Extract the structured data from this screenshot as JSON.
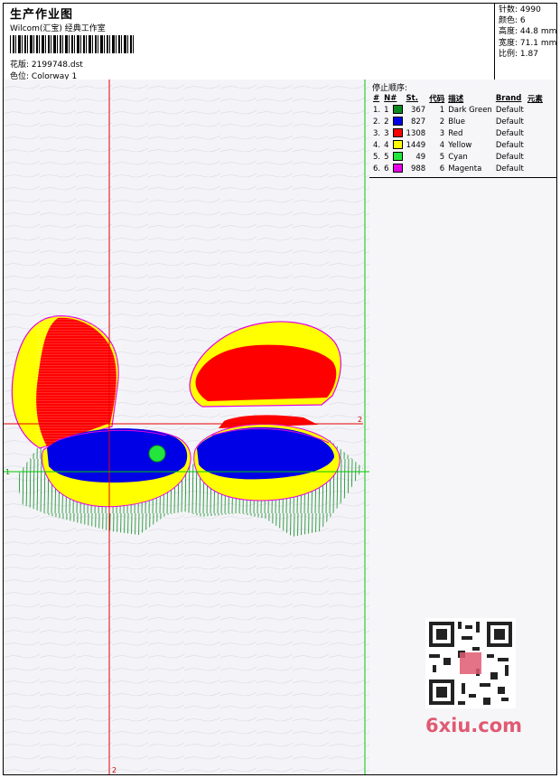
{
  "header": {
    "title": "生产作业图",
    "company": "Wilcom(汇宝) 经典工作室",
    "file_label": "花版:",
    "file_value": "2199748.dst",
    "colorway_label": "色位:",
    "colorway_value": "Colorway 1"
  },
  "stats": {
    "stitches_label": "针数:",
    "stitches": "4990",
    "colors_label": "颜色:",
    "colors": "6",
    "height_label": "高度:",
    "height": "44.8 mm",
    "width_label": "宽度:",
    "width": "71.1 mm",
    "scale_label": "比例:",
    "scale": "1.87"
  },
  "stop_sequence": {
    "title": "停止顺序:",
    "columns": [
      "#",
      "N#",
      "St.",
      "代码",
      "描述",
      "Brand",
      "元素"
    ],
    "rows": [
      {
        "idx": "1.",
        "n": "1",
        "color": "#0a8a1e",
        "st": "367",
        "code": "1",
        "desc": "Dark Green",
        "brand": "Default"
      },
      {
        "idx": "2.",
        "n": "2",
        "color": "#0000e6",
        "st": "827",
        "code": "2",
        "desc": "Blue",
        "brand": "Default"
      },
      {
        "idx": "3.",
        "n": "3",
        "color": "#ff0000",
        "st": "1308",
        "code": "3",
        "desc": "Red",
        "brand": "Default"
      },
      {
        "idx": "4.",
        "n": "4",
        "color": "#ffff00",
        "st": "1449",
        "code": "4",
        "desc": "Yellow",
        "brand": "Default"
      },
      {
        "idx": "5.",
        "n": "5",
        "color": "#22e63c",
        "st": "49",
        "code": "5",
        "desc": "Cyan",
        "brand": "Default"
      },
      {
        "idx": "6.",
        "n": "6",
        "color": "#e600e6",
        "st": "988",
        "code": "6",
        "desc": "Magenta",
        "brand": "Default"
      }
    ]
  },
  "guides": {
    "marker_1": "1",
    "marker_2": "2",
    "marker_2b": "2"
  },
  "watermark": {
    "text": "6xiu.com"
  },
  "colors": {
    "red_guide": "#e60000",
    "green_guide": "#00c800"
  }
}
